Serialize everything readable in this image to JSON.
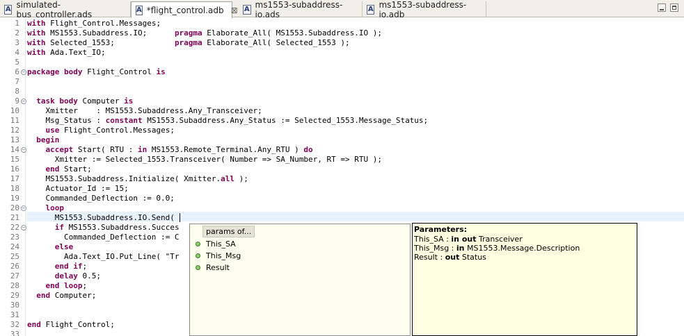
{
  "tabs": [
    {
      "label": "simulated-bus_controller.ads",
      "active": false,
      "icon": "ada-file-icon"
    },
    {
      "label": "*flight_control.adb",
      "active": true,
      "icon": "ada-file-icon",
      "closable": true
    },
    {
      "label": "ms1553-subaddress-io.ads",
      "active": false,
      "icon": "ada-file-icon"
    },
    {
      "label": "ms1553-subaddress-io.adb",
      "active": false,
      "icon": "ada-file-icon"
    }
  ],
  "editor": {
    "current_line": 21,
    "lines": [
      {
        "n": "1",
        "code": "<k>with</k> Flight_Control.Messages;"
      },
      {
        "n": "2",
        "code": "<k>with</k> MS1553.Subaddress.IO;      <k>pragma</k> Elaborate_All( MS1553.Subaddress.IO );"
      },
      {
        "n": "3",
        "code": "<k>with</k> Selected_1553;             <k>pragma</k> Elaborate_All( Selected_1553 );"
      },
      {
        "n": "4",
        "code": "<k>with</k> Ada.Text_IO;"
      },
      {
        "n": "5",
        "code": ""
      },
      {
        "n": "6",
        "code": "<k>package body</k> Flight_Control <k>is</k>",
        "fold": true
      },
      {
        "n": "7",
        "code": ""
      },
      {
        "n": "8",
        "code": ""
      },
      {
        "n": "9",
        "code": "  <k>task body</k> Computer <k>is</k>",
        "fold": true
      },
      {
        "n": "10",
        "code": "    Xmitter    : MS1553.Subaddress.Any_Transceiver;"
      },
      {
        "n": "11",
        "code": "    Msg_Status : <k>constant</k> MS1553.Subaddress.Any_Status := Selected_1553.Message_Status;"
      },
      {
        "n": "12",
        "code": "    <k>use</k> Flight_Control.Messages;"
      },
      {
        "n": "13",
        "code": "  <k>begin</k>"
      },
      {
        "n": "14",
        "code": "    <k>accept</k> Start( RTU : <k>in</k> MS1553.Remote_Terminal.Any_RTU ) <k>do</k>",
        "fold": true
      },
      {
        "n": "15",
        "code": "      Xmitter := Selected_1553.Transceiver( Number => SA_Number, RT => RTU );"
      },
      {
        "n": "16",
        "code": "    <k>end</k> Start;"
      },
      {
        "n": "17",
        "code": "    MS1553.Subaddress.Initialize( Xmitter.<k>all</k> );"
      },
      {
        "n": "18",
        "code": "    Actuator_Id := 15;"
      },
      {
        "n": "19",
        "code": "    Commanded_Deflection := 0.0;"
      },
      {
        "n": "20",
        "code": "    <k>loop</k>",
        "fold": true
      },
      {
        "n": "21",
        "code": "      MS1553.Subaddress.IO.Send( <caret>"
      },
      {
        "n": "22",
        "code": "      <k>if</k> MS1553.Subaddress.Succes",
        "fold": true
      },
      {
        "n": "23",
        "code": "        Commanded_Deflection := C"
      },
      {
        "n": "24",
        "code": "      <k>else</k>"
      },
      {
        "n": "25",
        "code": "        Ada.Text_IO.Put_Line( \"Tr"
      },
      {
        "n": "26",
        "code": "      <k>end if</k>;"
      },
      {
        "n": "27",
        "code": "      <k>delay</k> 0.5;"
      },
      {
        "n": "28",
        "code": "    <k>end loop</k>;"
      },
      {
        "n": "29",
        "code": "  <k>end</k> Computer;"
      },
      {
        "n": "30",
        "code": ""
      },
      {
        "n": "31",
        "code": ""
      },
      {
        "n": "32",
        "code": "<k>end</k> Flight_Control;"
      },
      {
        "n": "33",
        "code": ""
      }
    ]
  },
  "proposals": {
    "header": "params of...",
    "items": [
      "This_SA",
      "This_Msg",
      "Result"
    ]
  },
  "params_info": {
    "title": "Parameters:",
    "rows": [
      {
        "name": "This_SA",
        "sep": " : ",
        "mode": "in out",
        "type": " Transceiver"
      },
      {
        "name": "This_Msg",
        "sep": " : ",
        "mode": "in",
        "type": " MS1553.Message.Description"
      },
      {
        "name": "Result",
        "sep": " : ",
        "mode": "out",
        "type": " Status"
      }
    ]
  },
  "colors": {
    "keyword": "#7f0055",
    "current_line": "#e8f2fe",
    "tooltip_bg": "#ffffe1"
  }
}
